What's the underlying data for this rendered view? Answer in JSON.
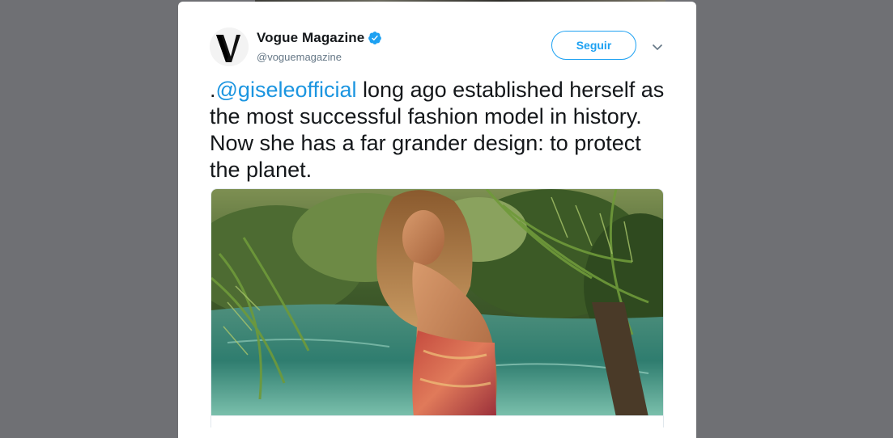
{
  "tweet": {
    "author_name": "Vogue Magazine",
    "author_handle": "@voguemagazine",
    "verified": true,
    "follow_label": "Seguir",
    "text_prefix": ".",
    "mention": "@giseleofficial",
    "text_body": " long ago established herself as the most successful fashion model in history. Now she has a far grander design: to protect the planet.",
    "media": {
      "kind": "photo",
      "subject": "model-in-tropical-lagoon"
    }
  },
  "icons": {
    "avatar": "vogue-v-logo",
    "verified": "verified-badge-icon",
    "caret": "chevron-down-icon"
  },
  "colors": {
    "accent": "#1da1f2",
    "mention": "#1b95e0",
    "text": "#14171a",
    "secondary": "#657786",
    "backdrop": "#6f7074"
  }
}
